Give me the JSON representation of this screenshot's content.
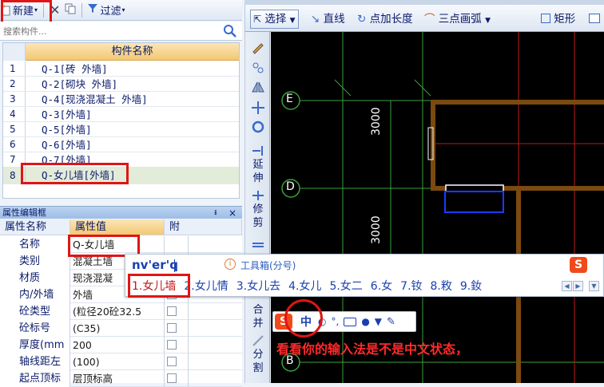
{
  "left_toolbar": {
    "new_label": "新建",
    "filter_label": "过滤"
  },
  "search": {
    "placeholder": "搜索构件..."
  },
  "component_table": {
    "header": "构件名称",
    "rows": [
      {
        "num": "1",
        "name": "Q-1[砖 外墙]"
      },
      {
        "num": "2",
        "name": "Q-2[砌块 外墙]"
      },
      {
        "num": "3",
        "name": "Q-4[现浇混凝土 外墙]"
      },
      {
        "num": "4",
        "name": "Q-3[外墙]"
      },
      {
        "num": "5",
        "name": "Q-5[外墙]"
      },
      {
        "num": "6",
        "name": "Q-6[外墙]"
      },
      {
        "num": "7",
        "name": "Q-7[外墙]"
      },
      {
        "num": "8",
        "name": "Q-女儿墙[外墙]"
      }
    ],
    "selected_index": 7
  },
  "property_panel": {
    "title": "属性编辑框",
    "pin": "ᵻ",
    "close": "×",
    "headers": {
      "name": "属性名称",
      "value": "属性值",
      "extra": "附"
    },
    "rows": [
      {
        "name": "名称",
        "value": "Q-女儿墙",
        "check": false
      },
      {
        "name": "类别",
        "value": "混凝土墙",
        "check": false
      },
      {
        "name": "材质",
        "value": "现浇混凝",
        "check": false
      },
      {
        "name": "内/外墙",
        "value": "外墙",
        "check": true
      },
      {
        "name": "砼类型",
        "value": "(粒径20砼32.5",
        "check": true
      },
      {
        "name": "砼标号",
        "value": "(C35)",
        "check": true
      },
      {
        "name": "厚度(mm",
        "value": "200",
        "check": true
      },
      {
        "name": "轴线距左",
        "value": "(100)",
        "check": true
      },
      {
        "name": "起点顶标",
        "value": "层顶标高",
        "check": true
      }
    ]
  },
  "draw_toolbar": {
    "select_label": "选择",
    "line_label": "直线",
    "point_length_label": "点加长度",
    "arc_label": "三点画弧",
    "rect_label": "矩形"
  },
  "vertical_toolbar": {
    "extend_label": "延伸",
    "trim_label": "修剪",
    "merge_label": "合并",
    "split_label": "分割"
  },
  "canvas": {
    "axis_labels": [
      "E",
      "D",
      "B"
    ],
    "dimensions": [
      "3000",
      "3000"
    ]
  },
  "ime": {
    "composition": "nv'er'q",
    "hint": "工具箱(分号)",
    "candidates": [
      "1.女儿墙",
      "2.女儿情",
      "3.女儿去",
      "4.女儿",
      "5.女二",
      "6.女",
      "7.钕",
      "8.敉",
      "9.釹"
    ],
    "status_mode": "中"
  },
  "annotation": "看看你的输入法是不是中文状态，",
  "colors": {
    "highlight_red": "#e01515",
    "wall_brown": "#7a4a10",
    "grid_green": "#3ca03c",
    "grid_red": "#c01818"
  }
}
